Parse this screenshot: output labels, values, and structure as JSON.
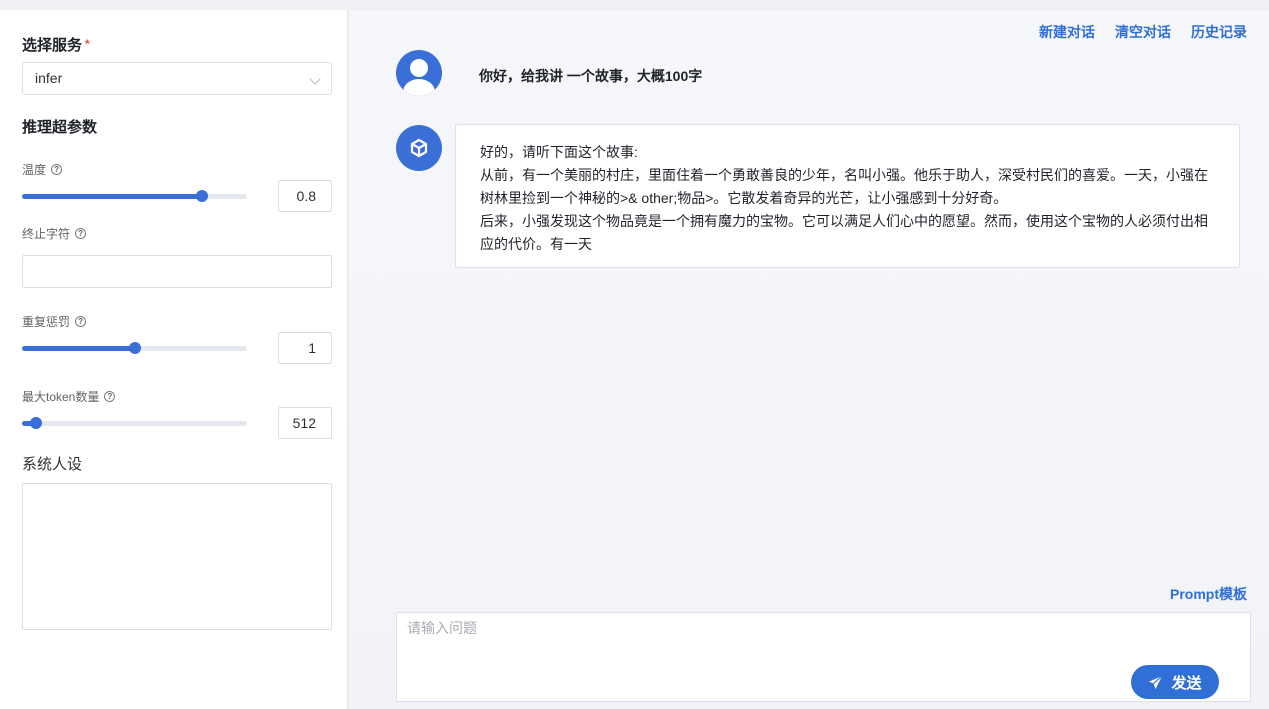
{
  "sidebar": {
    "service_title": "选择服务",
    "required_mark": "*",
    "service_value": "infer",
    "params_title": "推理超参数",
    "temperature": {
      "label": "温度",
      "value": "0.8",
      "level": 0.8
    },
    "stop_sequence": {
      "label": "终止字符",
      "value": ""
    },
    "repeat_penalty": {
      "label": "重复惩罚",
      "value": "1",
      "level": 0.5
    },
    "max_tokens": {
      "label": "最大token数量",
      "value": "512",
      "level": 0.06
    },
    "persona_label": "系统人设",
    "help_glyph": "?"
  },
  "header": {
    "new_chat": "新建对话",
    "clear_chat": "清空对话",
    "history": "历史记录"
  },
  "conversation": {
    "user_message": "你好，给我讲 一个故事，大概100字",
    "bot_lines": [
      "好的，请听下面这个故事:",
      "从前，有一个美丽的村庄，里面住着一个勇敢善良的少年，名叫小强。他乐于助人，深受村民们的喜爱。一天，小强在树林里捡到一个神秘的>& other;物品>。它散发着奇异的光芒，让小强感到十分好奇。",
      "后来，小强发现这个物品竟是一个拥有魔力的宝物。它可以满足人们心中的愿望。然而，使用这个宝物的人必须付出相应的代价。有一天"
    ]
  },
  "composer": {
    "prompt_template": "Prompt模板",
    "placeholder": "请输入问题",
    "send_label": "发送"
  },
  "colors": {
    "accent": "#2f6fd6",
    "slider": "#3b6fd8",
    "required": "#e34d4d"
  },
  "icons": [
    "chevron-down-icon",
    "help-icon",
    "user-avatar-icon",
    "cube-icon",
    "paper-plane-icon"
  ]
}
